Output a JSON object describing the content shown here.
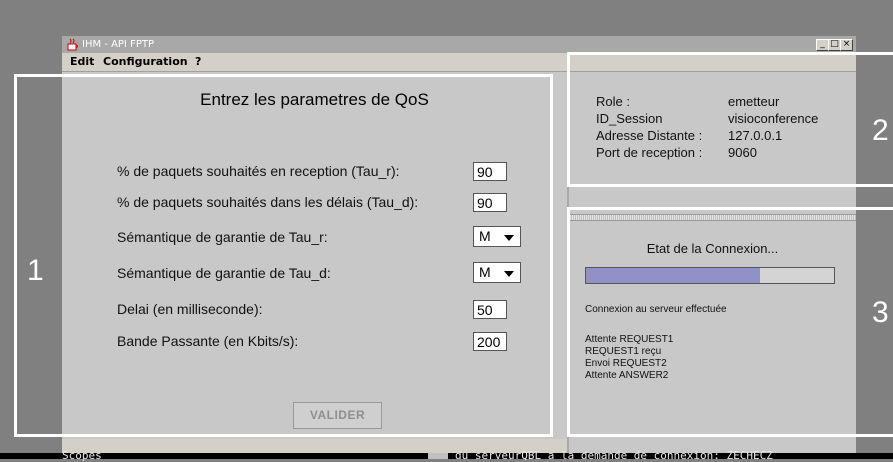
{
  "window": {
    "title": "IHM - API FPTP",
    "app_icon": "java-cup-icon"
  },
  "window_controls": {
    "minimize": "_",
    "maximize": "□",
    "close": "×"
  },
  "menu": {
    "items": [
      "Edit",
      "Configuration",
      "?"
    ]
  },
  "qos": {
    "title": "Entrez les parametres de QoS",
    "params": [
      {
        "label": "% de paquets souhaités en reception (Tau_r):",
        "value": "90",
        "kind": "input"
      },
      {
        "label": "% de paquets souhaités dans les délais (Tau_d):",
        "value": "90",
        "kind": "input"
      },
      {
        "label": "Sémantique de garantie de Tau_r:",
        "value": "M",
        "kind": "select"
      },
      {
        "label": "Sémantique de garantie de Tau_d:",
        "value": "M",
        "kind": "select"
      },
      {
        "label": "Delai (en milliseconde):",
        "value": "50",
        "kind": "input"
      },
      {
        "label": "Bande Passante (en Kbits/s):",
        "value": "200",
        "kind": "input"
      }
    ],
    "submit_label": "VALIDER"
  },
  "session_info": [
    {
      "label": "Role :",
      "value": "emetteur"
    },
    {
      "label": "ID_Session",
      "value": "visioconference"
    },
    {
      "label": "Adresse Distante :",
      "value": "127.0.0.1"
    },
    {
      "label": "Port de reception :",
      "value": "9060"
    }
  ],
  "connection": {
    "title": "Etat de la Connexion...",
    "progress": 0.7,
    "status": "Connexion au serveur effectuée",
    "log": [
      "Attente REQUEST1",
      "REQUEST1 reçu",
      "Envoi REQUEST2",
      "Attente ANSWER2"
    ]
  },
  "console": {
    "left_text": "Scopes",
    "right_text": "du serveurQBL a la demande de connexion: ZECHECZ"
  },
  "regions": [
    "1",
    "2",
    "3"
  ],
  "colors": {
    "progress_fill": "#9191c8",
    "annotation": "#ffffff",
    "panel": "#c8c8c8"
  }
}
